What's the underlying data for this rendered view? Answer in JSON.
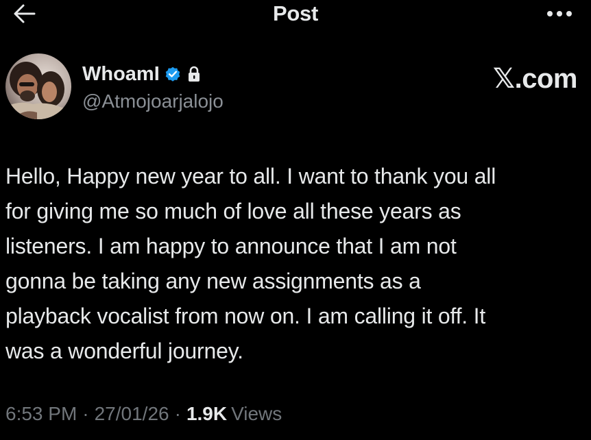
{
  "header": {
    "title": "Post",
    "back_icon": "arrow-left-icon",
    "more_icon": "ellipsis-horizontal-icon"
  },
  "author": {
    "display_name": "WhoamI",
    "handle": "@Atmojoarjalojo",
    "verified_icon": "verified-badge-icon",
    "lock_icon": "lock-icon",
    "badge_color": "#1d9bf0"
  },
  "watermark": "𝕏.com",
  "tweet": {
    "lines": [
      "Hello, Happy new year to all. I want to thank you all",
      "for giving me so much of love all these years as",
      "listeners. I am happy to announce that I am not",
      "gonna be taking any new assignments as a",
      "playback vocalist from now on. I am calling it off. It",
      "was a wonderful journey."
    ]
  },
  "meta": {
    "time": "6:53 PM",
    "separator": "·",
    "date": "27/01/26",
    "views_count": "1.9K",
    "views_label": "Views"
  }
}
